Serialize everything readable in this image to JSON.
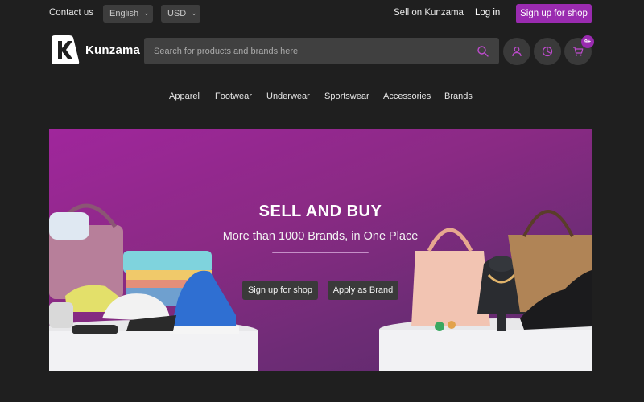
{
  "topbar": {
    "contact": "Contact us",
    "language": "English",
    "currency": "USD",
    "sell": "Sell on Kunzama",
    "login": "Log in",
    "signup": "Sign up for shop"
  },
  "header": {
    "brand": "Kunzama",
    "search_placeholder": "Search for products and brands here",
    "cart_badge": "9+"
  },
  "nav": {
    "items": [
      {
        "label": "Apparel"
      },
      {
        "label": "Footwear"
      },
      {
        "label": "Underwear"
      },
      {
        "label": "Sportswear"
      },
      {
        "label": "Accessories"
      },
      {
        "label": "Brands"
      }
    ]
  },
  "hero": {
    "title": "SELL AND BUY",
    "subtitle": "More than 1000 Brands, in One Place",
    "signup_button": "Sign up for shop",
    "brand_button": "Apply as Brand"
  },
  "colors": {
    "accent": "#9a2bb0",
    "background": "#1f1f1f",
    "control": "#3d3d3d"
  },
  "icons": [
    "chevron-down-icon",
    "search-icon",
    "user-icon",
    "history-icon",
    "cart-icon",
    "kunzama-logo"
  ]
}
